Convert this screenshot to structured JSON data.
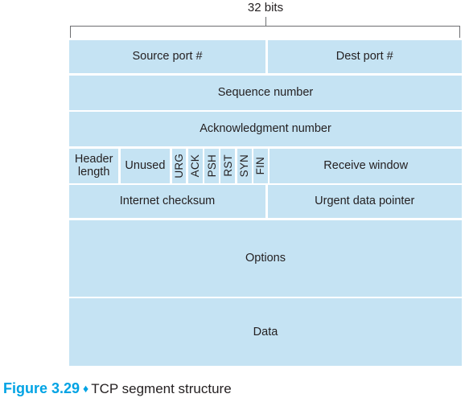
{
  "figure": {
    "width_label": "32 bits",
    "caption_number": "Figure 3.29",
    "caption_diamond": "♦",
    "caption_text": "TCP segment structure",
    "accent_color": "#00a3e4",
    "field_fill_color": "#c5e3f3",
    "bracket_color": "#6d6e71",
    "text_color": "#231f20"
  },
  "diagram": {
    "rows": [
      {
        "name": "ports",
        "cells": [
          {
            "label": "Source port #"
          },
          {
            "label": "Dest port #"
          }
        ]
      },
      {
        "name": "sequence",
        "cells": [
          {
            "label": "Sequence number"
          }
        ]
      },
      {
        "name": "acknowledgment",
        "cells": [
          {
            "label": "Acknowledgment number"
          }
        ]
      },
      {
        "name": "flags",
        "cells": [
          {
            "label_line1": "Header",
            "label_line2": "length"
          },
          {
            "label": "Unused"
          },
          {
            "label": "URG"
          },
          {
            "label": "ACK"
          },
          {
            "label": "PSH"
          },
          {
            "label": "RST"
          },
          {
            "label": "SYN"
          },
          {
            "label": "FIN"
          },
          {
            "label": "Receive window"
          }
        ]
      },
      {
        "name": "checksum",
        "cells": [
          {
            "label": "Internet checksum"
          },
          {
            "label": "Urgent data pointer"
          }
        ]
      },
      {
        "name": "options",
        "cells": [
          {
            "label": "Options"
          }
        ]
      },
      {
        "name": "data",
        "cells": [
          {
            "label": "Data"
          }
        ]
      }
    ]
  }
}
